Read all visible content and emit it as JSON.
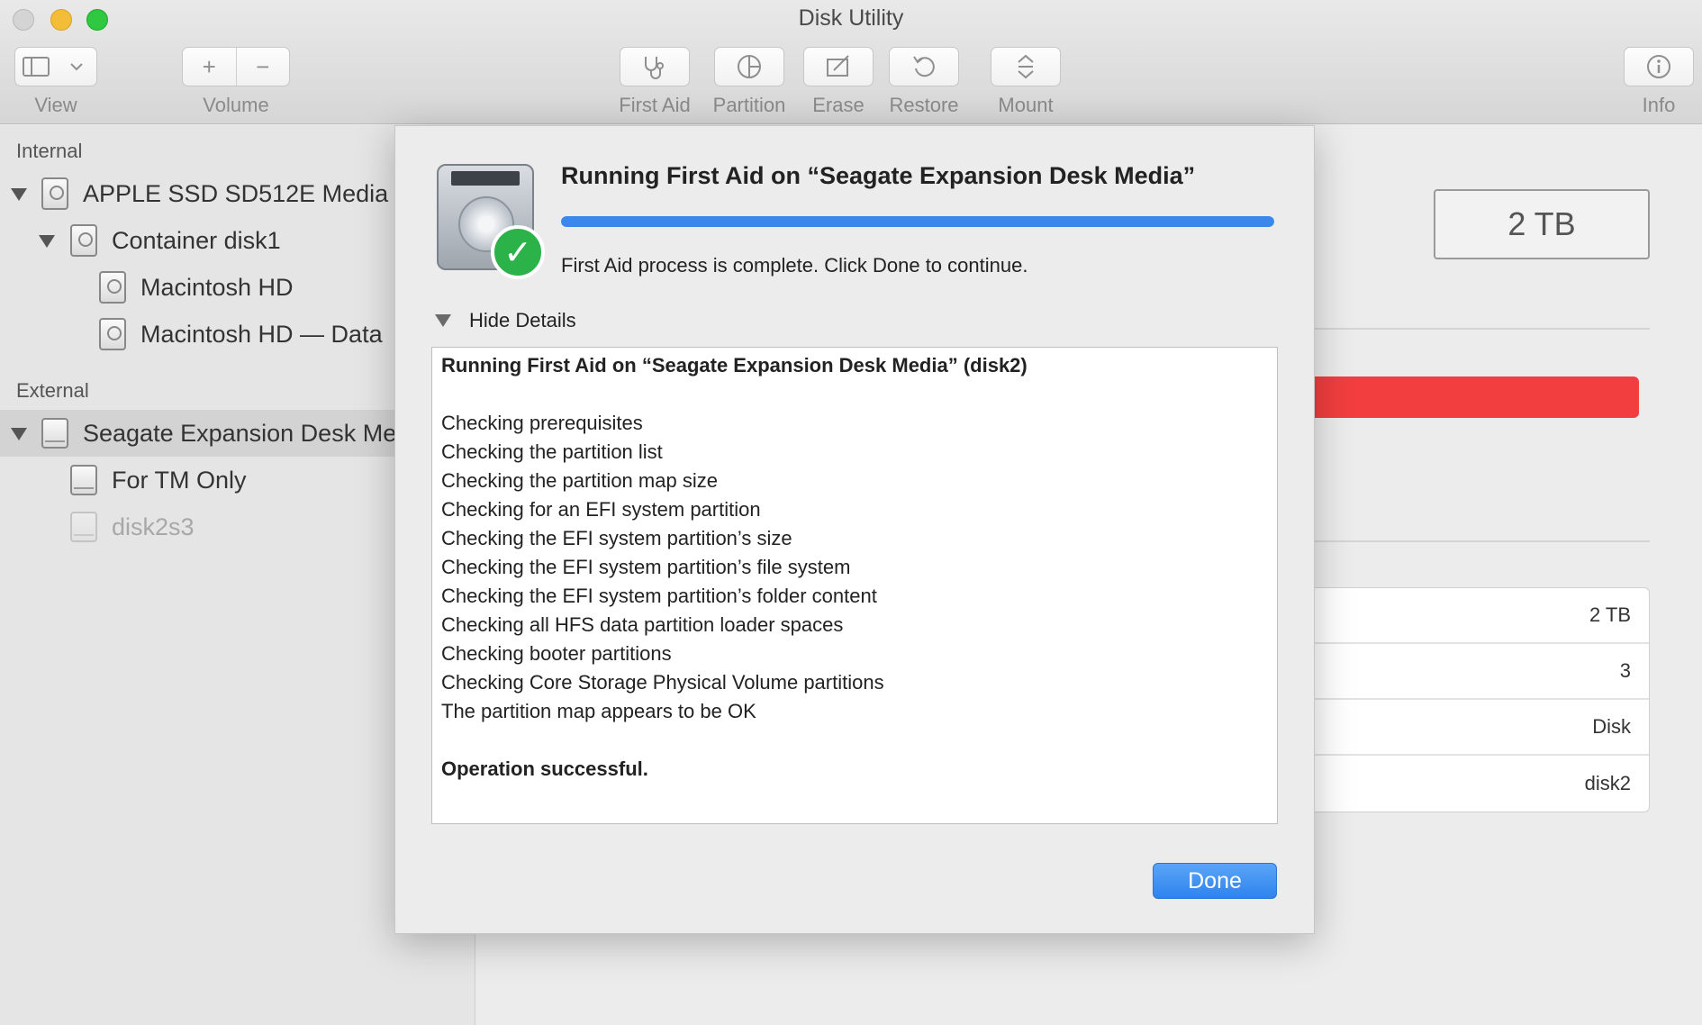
{
  "window": {
    "title": "Disk Utility"
  },
  "toolbar": {
    "view_label": "View",
    "volume_label": "Volume",
    "first_aid_label": "First Aid",
    "partition_label": "Partition",
    "erase_label": "Erase",
    "restore_label": "Restore",
    "mount_label": "Mount",
    "info_label": "Info",
    "add_glyph": "+",
    "remove_glyph": "−"
  },
  "sidebar": {
    "internal_header": "Internal",
    "external_header": "External",
    "items": [
      {
        "label": "APPLE SSD SD512E Media"
      },
      {
        "label": "Container disk1"
      },
      {
        "label": "Macintosh HD"
      },
      {
        "label": "Macintosh HD — Data"
      },
      {
        "label": "Seagate Expansion Desk Media"
      },
      {
        "label": "For TM Only"
      },
      {
        "label": "disk2s3"
      }
    ]
  },
  "main": {
    "capacity": "2 TB",
    "info_values": [
      "2 TB",
      "3",
      "Disk",
      "disk2"
    ]
  },
  "sheet": {
    "title": "Running First Aid on “Seagate Expansion Desk Media”",
    "progress": 1.0,
    "status": "First Aid process is complete. Click Done to continue.",
    "details_toggle": "Hide Details",
    "log": {
      "header": "Running First Aid on “Seagate Expansion Desk Media” (disk2)",
      "lines": [
        "Checking prerequisites",
        "Checking the partition list",
        "Checking the partition map size",
        "Checking for an EFI system partition",
        "Checking the EFI system partition’s size",
        "Checking the EFI system partition’s file system",
        "Checking the EFI system partition’s folder content",
        "Checking all HFS data partition loader spaces",
        "Checking booter partitions",
        "Checking Core Storage Physical Volume partitions",
        "The partition map appears to be OK"
      ],
      "result": "Operation successful."
    },
    "done_label": "Done"
  },
  "colors": {
    "accent": "#3b88ec",
    "usage_bar": "#f23e3e",
    "success": "#2bb34a"
  }
}
